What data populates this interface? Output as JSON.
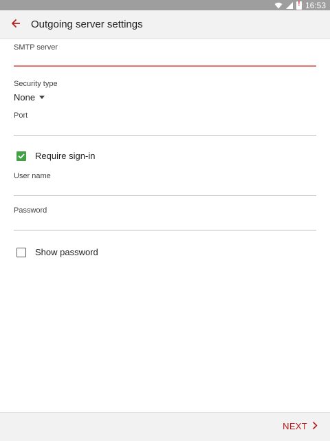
{
  "status_bar": {
    "time": "16:53",
    "icons": [
      "wifi-icon",
      "signal-icon",
      "battery-alert-icon"
    ]
  },
  "app_bar": {
    "back_icon": "arrow-left-icon",
    "title": "Outgoing server settings"
  },
  "form": {
    "smtp_server": {
      "label": "SMTP server",
      "value": ""
    },
    "security_type": {
      "label": "Security type",
      "value": "None"
    },
    "port": {
      "label": "Port",
      "value": ""
    },
    "require_signin": {
      "label": "Require sign-in",
      "checked": true
    },
    "user_name": {
      "label": "User name",
      "value": ""
    },
    "password": {
      "label": "Password",
      "value": ""
    },
    "show_password": {
      "label": "Show password",
      "checked": false
    }
  },
  "footer": {
    "next_label": "NEXT"
  },
  "colors": {
    "accent": "#b71c1c",
    "active_underline": "#e57373",
    "checkbox_checked": "#43a047",
    "status_bar": "#9e9e9e",
    "bar_background": "#f2f2f2"
  }
}
